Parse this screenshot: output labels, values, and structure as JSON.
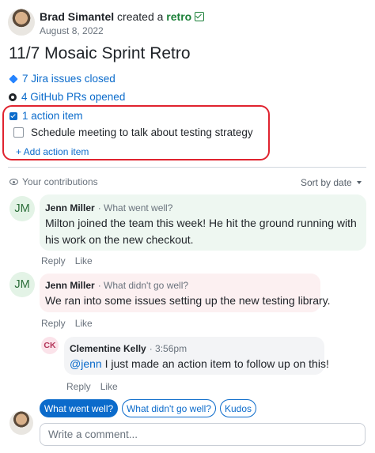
{
  "header": {
    "author": "Brad Simantel",
    "created_text": "created a",
    "type_label": "retro",
    "type_icon": "check-square-icon",
    "date": "August 8, 2022"
  },
  "title": "11/7 Mosaic Sprint Retro",
  "links": {
    "jira": {
      "icon": "jira-icon",
      "label": "7 Jira issues closed"
    },
    "github": {
      "icon": "github-icon",
      "label": "4 GitHub PRs opened"
    }
  },
  "action_items": {
    "header_label": "1 action item",
    "items": [
      {
        "label": "Schedule meeting to talk about testing strategy",
        "checked": false
      }
    ],
    "add_label": "+ Add action item",
    "highlight_color": "#e0232f"
  },
  "contributions": {
    "label": "Your contributions",
    "sort_label": "Sort by date"
  },
  "comments": [
    {
      "initials": "JM",
      "author": "Jenn Miller",
      "meta": "· What went well?",
      "body": "Milton joined the team this week! He hit the ground running with his work on the new checkout.",
      "reply_label": "Reply",
      "like_label": "Like",
      "color": "#eef7f1"
    },
    {
      "initials": "JM",
      "author": "Jenn Miller",
      "meta": "· What didn't go well?",
      "body": "We ran into some issues setting up the new testing library.",
      "reply_label": "Reply",
      "like_label": "Like",
      "color": "#fcf0f1",
      "replies": [
        {
          "initials": "CK",
          "author": "Clementine Kelly",
          "meta": "· 3:56pm",
          "mention": "@jenn",
          "body": " I just made an action item to follow up on this!",
          "reply_label": "Reply",
          "like_label": "Like"
        }
      ]
    }
  ],
  "composer": {
    "chips": [
      "What went well?",
      "What didn't go well?",
      "Kudos"
    ],
    "active_chip": "What went well?",
    "placeholder": "Write a comment..."
  },
  "colors": {
    "accent": "#0b6bcb",
    "retro_green": "#1a7f37"
  }
}
